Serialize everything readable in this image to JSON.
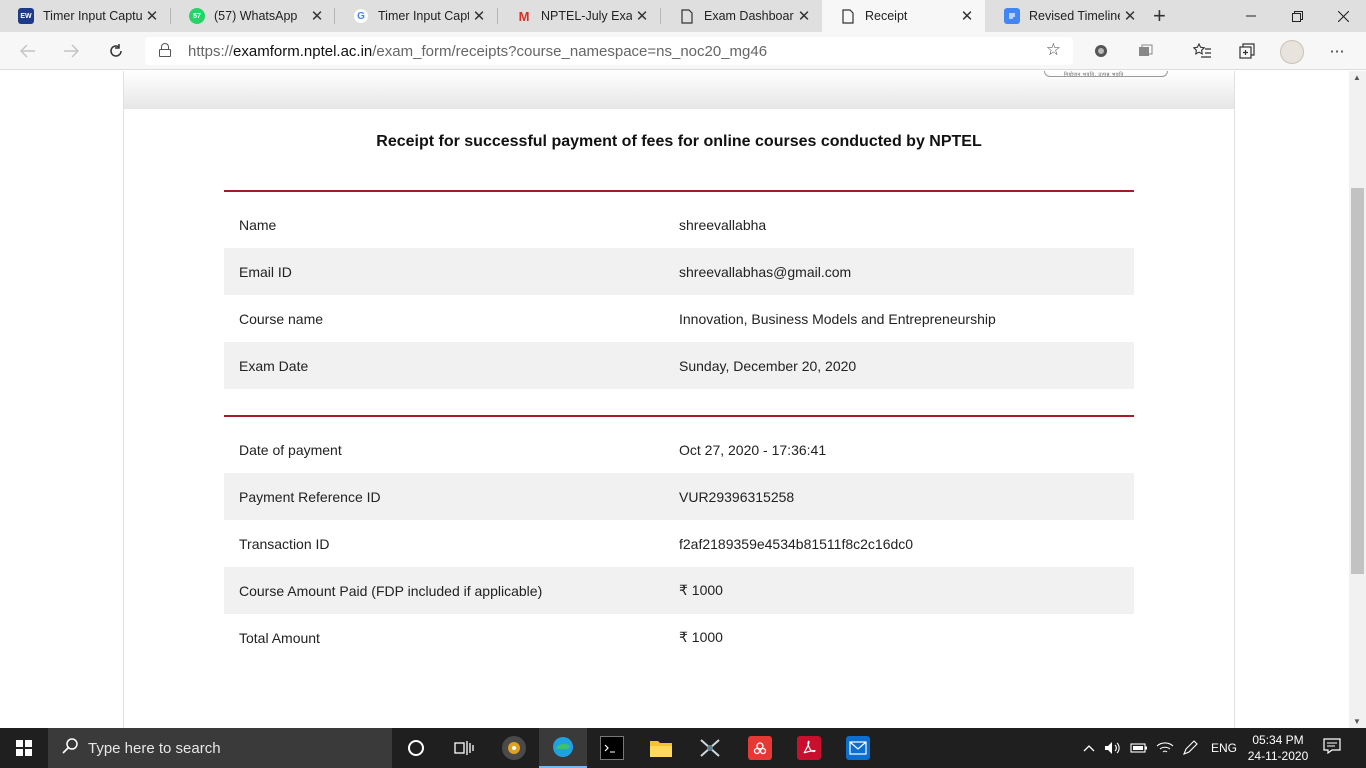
{
  "browser": {
    "tabs": [
      {
        "title": "Timer Input Captu",
        "favicon": "ew-icon",
        "favicon_text": "EW"
      },
      {
        "title": "(57) WhatsApp",
        "favicon": "whatsapp-icon",
        "favicon_text": "57"
      },
      {
        "title": "Timer Input Captu",
        "favicon": "google-icon",
        "favicon_text": "G"
      },
      {
        "title": "NPTEL-July Exam F",
        "favicon": "gmail-icon",
        "favicon_text": "M"
      },
      {
        "title": "Exam Dashboard",
        "favicon": "page-icon",
        "favicon_text": ""
      },
      {
        "title": "Receipt",
        "favicon": "page-icon",
        "favicon_text": "",
        "active": true
      },
      {
        "title": "Revised Timelines",
        "favicon": "docs-icon",
        "favicon_text": ""
      }
    ],
    "new_tab_glyph": "+",
    "url_scheme": "https://",
    "url_host": "examform.nptel.ac.in",
    "url_path": "/exam_form/receipts?course_namespace=ns_noc20_mg46"
  },
  "page": {
    "title": "Receipt for successful payment of fees for online courses conducted by NPTEL",
    "logo_caption": "नियोजन भवति, उत्पन्न भवति",
    "student_rows": [
      {
        "label": "Name",
        "value": "shreevallabha"
      },
      {
        "label": "Email ID",
        "value": "shreevallabhas@gmail.com"
      },
      {
        "label": "Course name",
        "value": "Innovation, Business Models and Entrepreneurship"
      },
      {
        "label": "Exam Date",
        "value": "Sunday, December 20, 2020"
      }
    ],
    "payment_rows": [
      {
        "label": "Date of payment",
        "value": "Oct 27, 2020 - 17:36:41"
      },
      {
        "label": "Payment Reference ID",
        "value": "VUR29396315258"
      },
      {
        "label": "Transaction ID",
        "value": "f2af2189359e4534b81511f8c2c16dc0"
      },
      {
        "label": "Course Amount Paid (FDP included if applicable)",
        "value": "₹ 1000"
      },
      {
        "label": "Total Amount",
        "value": "₹ 1000"
      }
    ],
    "accent_color": "#a51c24"
  },
  "taskbar": {
    "search_placeholder": "Type here to search",
    "language": "ENG",
    "time": "05:34 PM",
    "date": "24-11-2020"
  }
}
